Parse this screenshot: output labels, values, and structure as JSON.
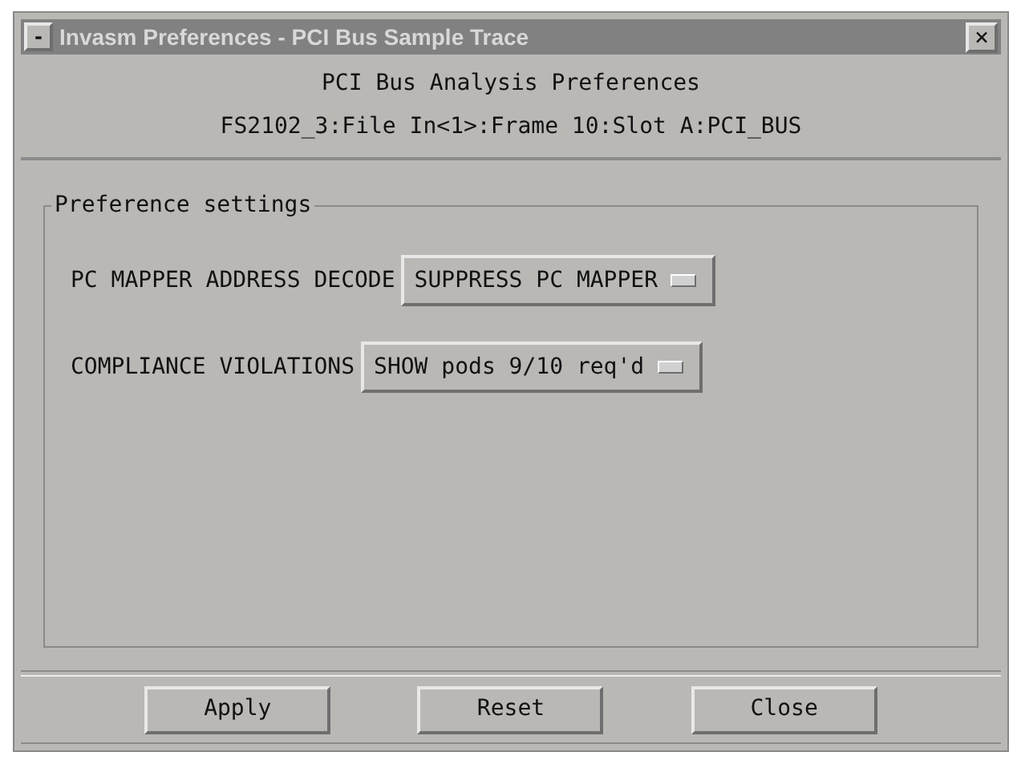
{
  "window": {
    "title": "Invasm Preferences - PCI Bus Sample Trace",
    "menu_button": "-",
    "close_button": "×"
  },
  "header": {
    "title": "PCI Bus Analysis Preferences",
    "path": "FS2102_3:File In<1>:Frame 10:Slot A:PCI_BUS"
  },
  "group": {
    "label": "Preference settings",
    "rows": [
      {
        "label": "PC MAPPER ADDRESS DECODE",
        "value": "SUPPRESS PC MAPPER"
      },
      {
        "label": "COMPLIANCE VIOLATIONS",
        "value": "SHOW pods 9/10 req'd"
      }
    ]
  },
  "buttons": [
    "Apply",
    "Reset",
    "Close"
  ]
}
